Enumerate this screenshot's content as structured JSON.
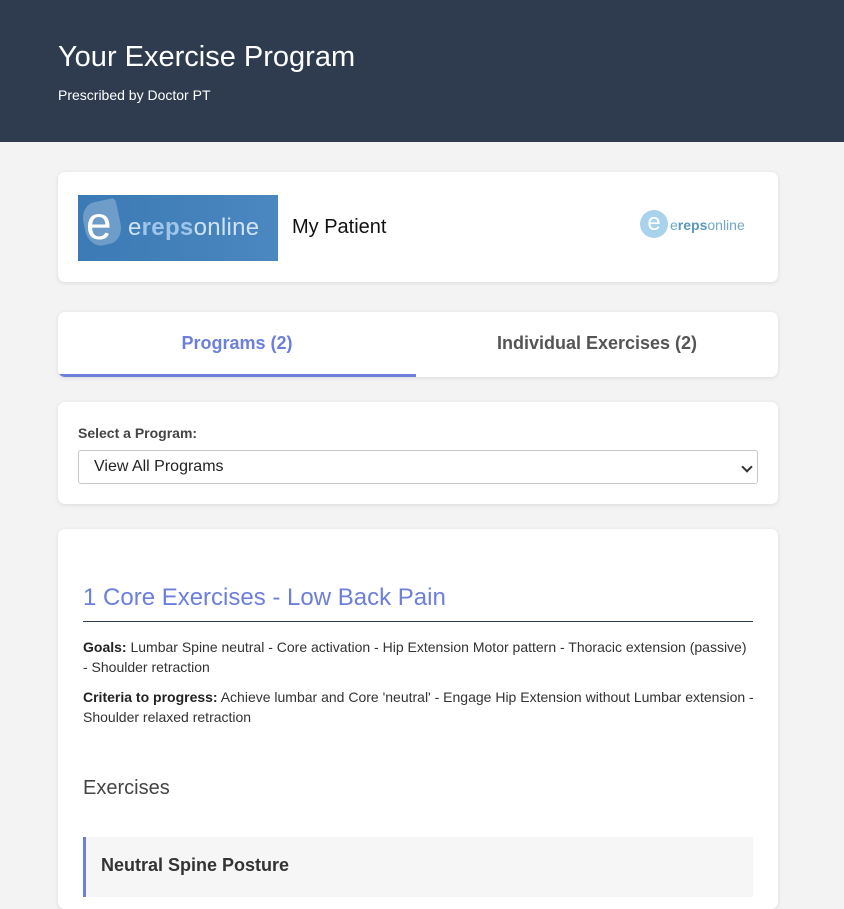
{
  "header": {
    "title": "Your Exercise Program",
    "subtitle": "Prescribed by Doctor PT"
  },
  "patient": {
    "logo_text_bold": "reps",
    "logo_text_prefix": "e",
    "logo_text_suffix": "online",
    "logo_e": "e",
    "name": "My Patient",
    "brand_e": "e",
    "brand_bold": "reps",
    "brand_prefix": "e",
    "brand_suffix": "online"
  },
  "tabs": [
    {
      "label": "Programs (2)",
      "active": true
    },
    {
      "label": "Individual Exercises (2)",
      "active": false
    }
  ],
  "program_select": {
    "label": "Select a Program:",
    "selected": "View All Programs"
  },
  "program": {
    "title": "1 Core Exercises - Low Back Pain",
    "goals_label": "Goals:",
    "goals_text": "Lumbar Spine neutral - Core activation - Hip Extension Motor pattern - Thoracic extension (passive) - Shoulder retraction",
    "criteria_label": "Criteria to progress:",
    "criteria_text": "Achieve lumbar and Core 'neutral' - Engage Hip Extension without Lumbar extension - Shoulder relaxed retraction",
    "exercises_heading": "Exercises",
    "exercises": [
      {
        "name": "Neutral Spine Posture"
      }
    ]
  },
  "colors": {
    "header_bg": "#2f3b4f",
    "accent": "#6b7fdb",
    "page_bg": "#f3f3f3"
  }
}
